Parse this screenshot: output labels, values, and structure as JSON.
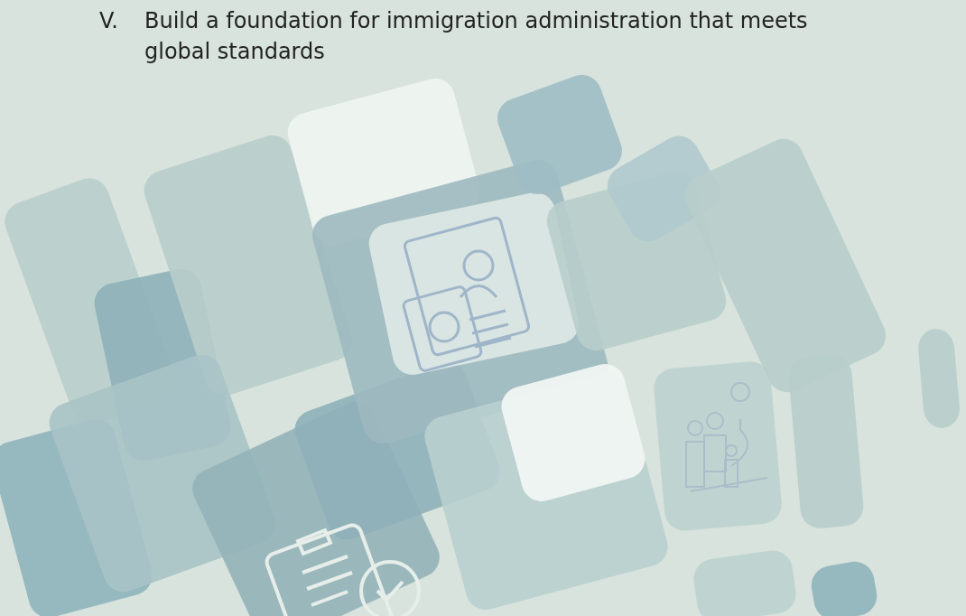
{
  "goal": {
    "marker": "V.",
    "text": "Build a foundation for immigration administration that meets global standards"
  }
}
